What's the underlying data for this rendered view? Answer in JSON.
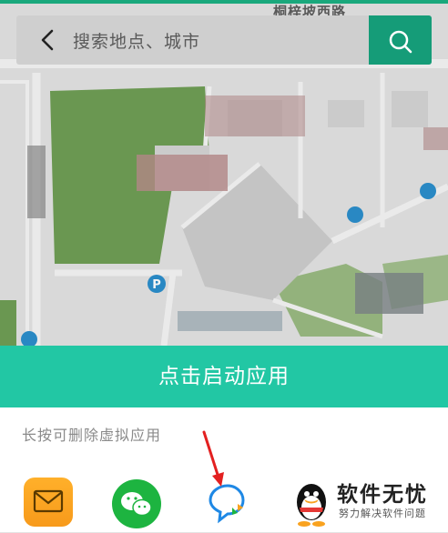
{
  "map": {
    "road_label": "桐梓坡西路"
  },
  "search": {
    "placeholder": "搜索地点、城市"
  },
  "launch": {
    "label": "点击启动应用"
  },
  "panel": {
    "hint": "长按可删除虚拟应用",
    "apps": [
      {
        "name": "mail-app",
        "icon": "envelope-icon",
        "color": "#f9a21f"
      },
      {
        "name": "wechat-app",
        "icon": "wechat-icon",
        "color": "#1db440"
      },
      {
        "name": "bubble-app",
        "icon": "chat-bubble-icon",
        "color": "#1e88e5"
      },
      {
        "name": "qq-app",
        "icon": "qq-penguin-icon",
        "color": "#111111"
      }
    ]
  },
  "watermark": {
    "title": "软件无忧",
    "subtitle": "努力解决软件问题"
  },
  "colors": {
    "accent": "#22c7a4",
    "search_button": "#159c78",
    "park": "#76a35b"
  }
}
